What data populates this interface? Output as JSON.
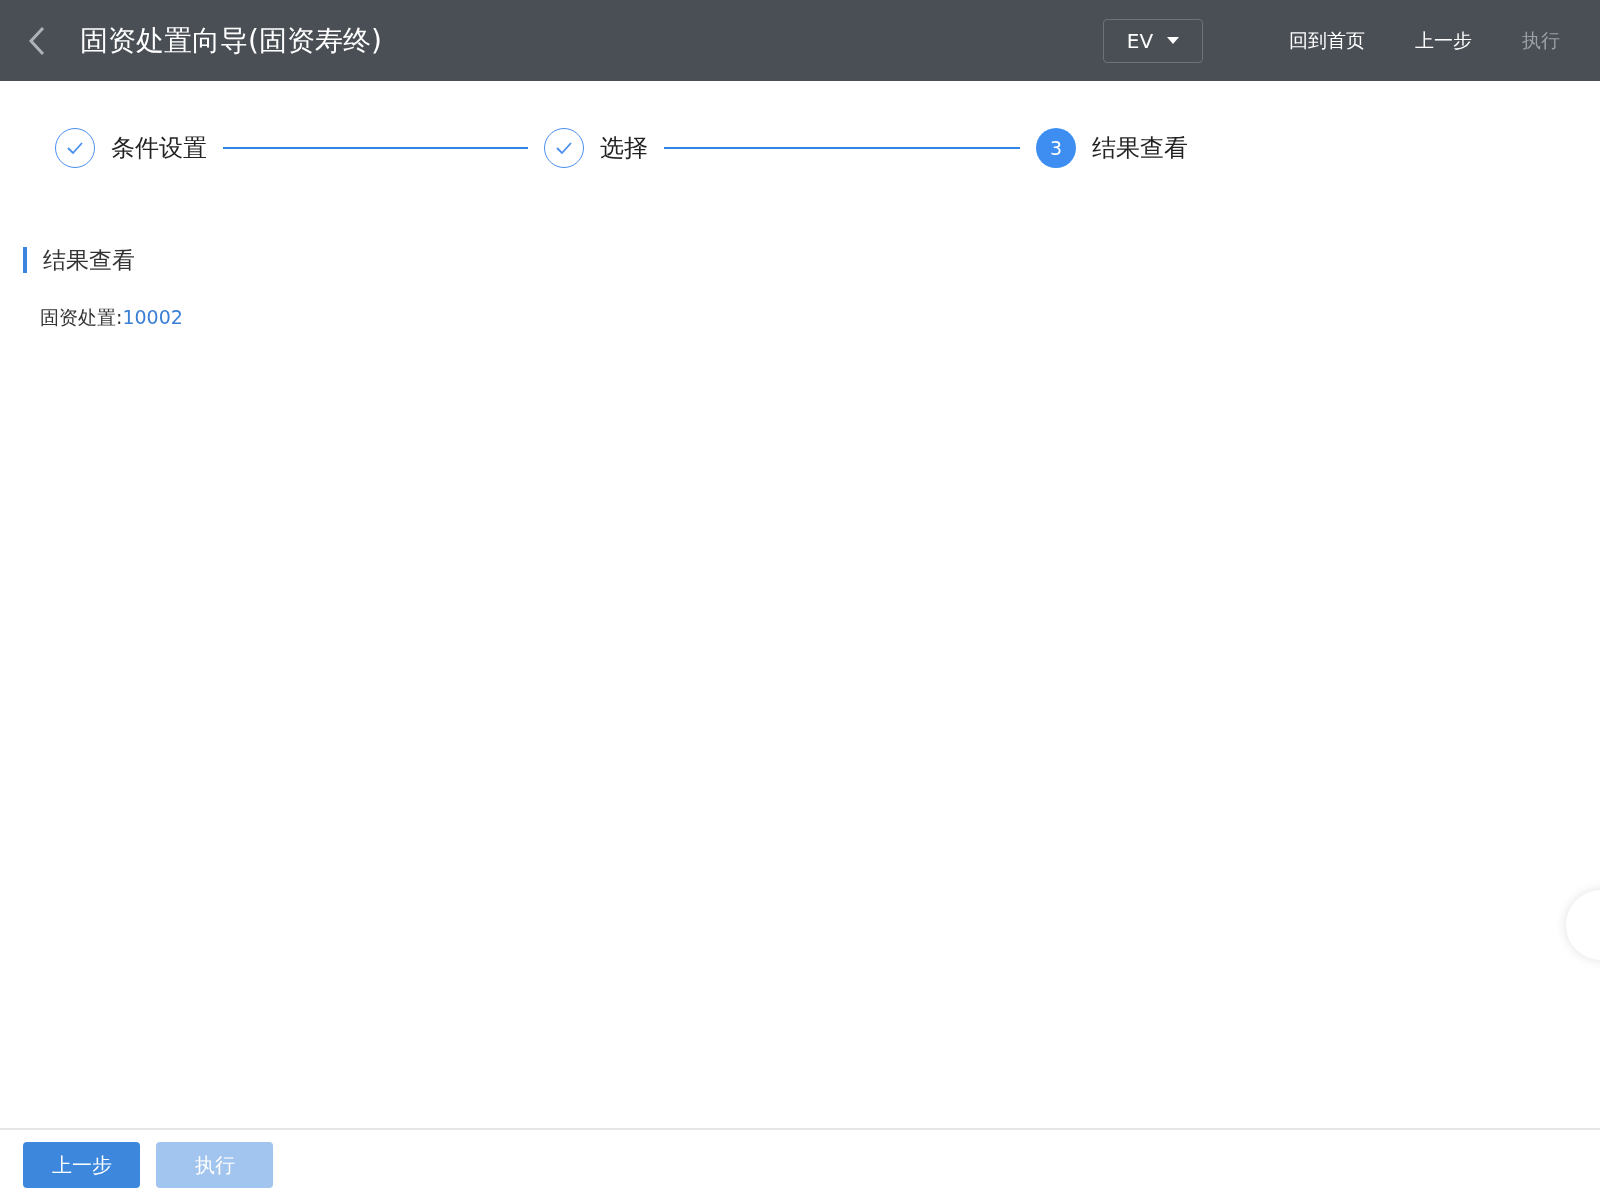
{
  "header": {
    "title": "固资处置向导(固资寿终)",
    "dropdown": "EV",
    "actions": [
      {
        "label": "回到首页",
        "disabled": false
      },
      {
        "label": "上一步",
        "disabled": false
      },
      {
        "label": "执行",
        "disabled": true
      }
    ]
  },
  "steps": [
    {
      "label": "条件设置",
      "kind": "done"
    },
    {
      "label": "选择",
      "kind": "done"
    },
    {
      "label": "结果查看",
      "kind": "current",
      "number": "3"
    }
  ],
  "section": {
    "title": "结果查看",
    "result_label": "固资处置:",
    "result_value": "10002"
  },
  "footer": {
    "buttons": [
      {
        "label": "上一步",
        "disabled": false
      },
      {
        "label": "执行",
        "disabled": true
      }
    ]
  }
}
